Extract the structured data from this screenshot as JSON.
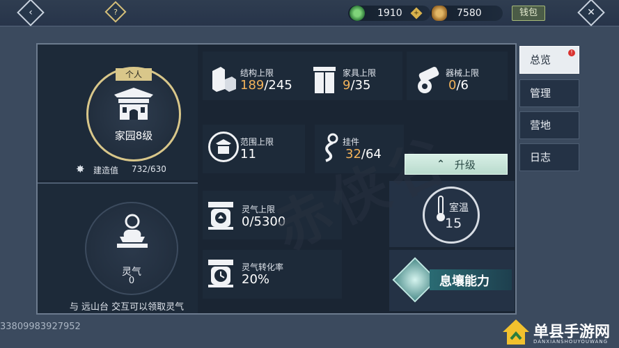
{
  "topbar": {
    "back_icon": "chevron-left-icon",
    "help_icon": "question-icon",
    "currency_jade": "1910",
    "add_icon": "plus-icon",
    "currency_copper": "7580",
    "wallet_label": "钱包",
    "close_icon": "close-icon"
  },
  "home": {
    "badge": "个人",
    "title": "家园8级",
    "build_label": "建造值",
    "build_value": "732/630"
  },
  "stats": {
    "structure": {
      "label": "结构上限",
      "cur": "189",
      "max": "/245"
    },
    "furniture": {
      "label": "家具上限",
      "cur": "9",
      "max": "/35"
    },
    "machine": {
      "label": "器械上限",
      "cur": "0",
      "max": "/6"
    },
    "range": {
      "label": "范围上限",
      "value": "11"
    },
    "pendant": {
      "label": "挂件",
      "cur": "32",
      "max": "/64"
    }
  },
  "upgrade_label": "升级",
  "spirit": {
    "title": "灵气",
    "value": "0",
    "hint": "与 远山台 交互可以领取灵气",
    "limit_label": "灵气上限",
    "limit_value": "0/5300",
    "rate_label": "灵气转化率",
    "rate_value": "20%"
  },
  "temperature": {
    "label": "室温",
    "value": "15"
  },
  "ability_label": "息壤能力",
  "tabs": [
    {
      "label": "总览",
      "badge": "!"
    },
    {
      "label": "管理"
    },
    {
      "label": "营地"
    },
    {
      "label": "日志"
    }
  ],
  "watermark_text": "赤侠谷",
  "uid": "33809983927952",
  "site_logo": {
    "name": "单县手游网",
    "sub": "DANXIANSHOUYOUWANG"
  },
  "colors": {
    "accent_orange": "#f2b25a",
    "upgrade_green": "#c6e6d9",
    "badge_red": "#d9322f"
  }
}
